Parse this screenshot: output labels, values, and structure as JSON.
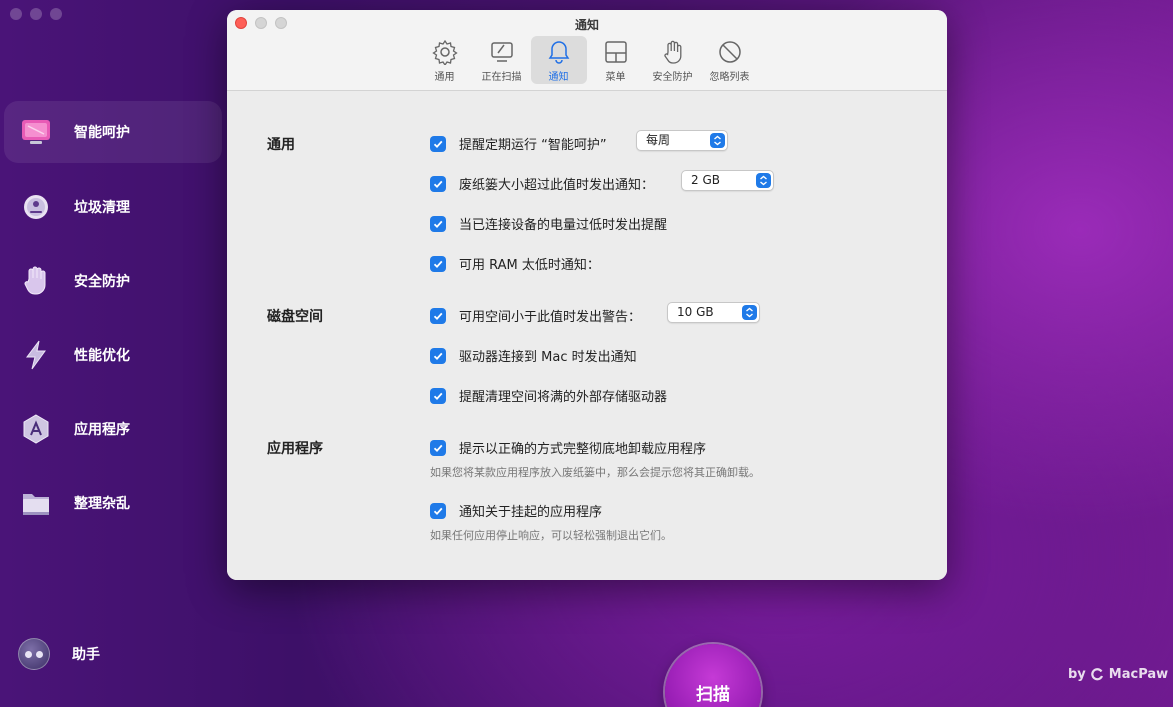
{
  "sidebar": {
    "items": [
      {
        "label": "智能呵护",
        "icon": "smart-care-icon"
      },
      {
        "label": "垃圾清理",
        "icon": "cleanup-icon"
      },
      {
        "label": "安全防护",
        "icon": "hand-shield-icon"
      },
      {
        "label": "性能优化",
        "icon": "lightning-icon"
      },
      {
        "label": "应用程序",
        "icon": "applications-icon"
      },
      {
        "label": "整理杂乱",
        "icon": "folder-icon"
      }
    ],
    "active_index": 0,
    "assistant_label": "助手"
  },
  "scan_button": "扫描",
  "brand": {
    "by": "by",
    "name": "MacPaw"
  },
  "prefs": {
    "title": "通知",
    "tabs": [
      {
        "label": "通用",
        "icon": "gear-icon"
      },
      {
        "label": "正在扫描",
        "icon": "scanning-monitor-icon"
      },
      {
        "label": "通知",
        "icon": "bell-icon"
      },
      {
        "label": "菜单",
        "icon": "menu-window-icon"
      },
      {
        "label": "安全防护",
        "icon": "hand-icon"
      },
      {
        "label": "忽略列表",
        "icon": "prohibited-icon"
      }
    ],
    "active_tab": 2,
    "sections": {
      "general": {
        "title": "通用",
        "options": [
          {
            "label": "提醒定期运行 “智能呵护”",
            "checked": true,
            "select": "每周"
          },
          {
            "label": "废纸篓大小超过此值时发出通知：",
            "checked": true,
            "select": "2 GB"
          },
          {
            "label": "当已连接设备的电量过低时发出提醒",
            "checked": true
          },
          {
            "label": "可用 RAM 太低时通知：",
            "checked": true
          }
        ]
      },
      "disk": {
        "title": "磁盘空间",
        "options": [
          {
            "label": "可用空间小于此值时发出警告：",
            "checked": true,
            "select": "10 GB"
          },
          {
            "label": "驱动器连接到 Mac 时发出通知",
            "checked": true
          },
          {
            "label": "提醒清理空间将满的外部存储驱动器",
            "checked": true
          }
        ]
      },
      "apps": {
        "title": "应用程序",
        "options": [
          {
            "label": "提示以正确的方式完整彻底地卸载应用程序",
            "checked": true,
            "hint": "如果您将某款应用程序放入废纸篓中，那么会提示您将其正确卸载。"
          },
          {
            "label": "通知关于挂起的应用程序",
            "checked": true,
            "hint": "如果任何应用停止响应，可以轻松强制退出它们。"
          }
        ]
      }
    }
  },
  "colors": {
    "accent": "#1f7ae8",
    "background": "#4a1478",
    "scan": "#a324bd"
  }
}
